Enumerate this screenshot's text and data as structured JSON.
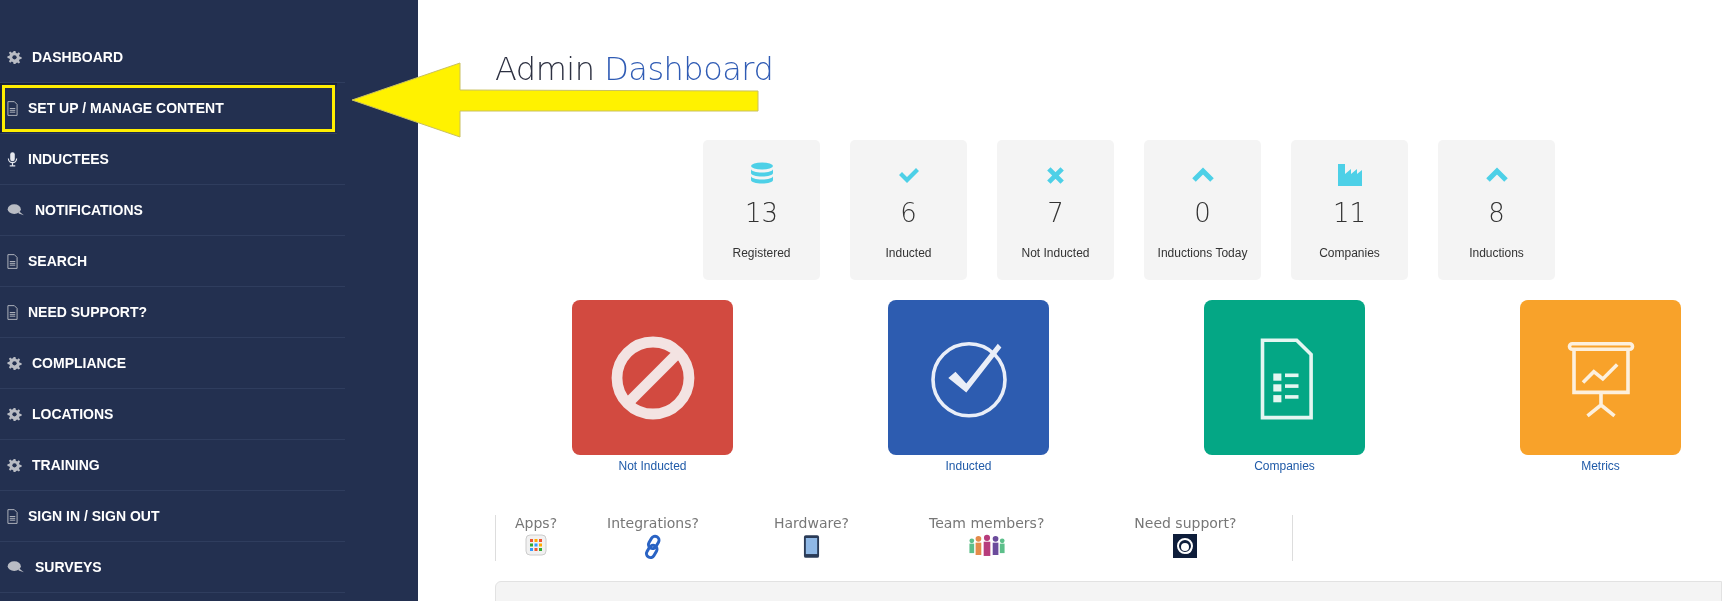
{
  "sidebar": {
    "items": [
      {
        "label": "DASHBOARD",
        "kind": "gear",
        "highlighted": false
      },
      {
        "label": "SET UP / MANAGE CONTENT",
        "kind": "doc",
        "highlighted": true
      },
      {
        "label": "INDUCTEES",
        "kind": "mic",
        "highlighted": false
      },
      {
        "label": "NOTIFICATIONS",
        "kind": "chat",
        "highlighted": false
      },
      {
        "label": "SEARCH",
        "kind": "doc",
        "highlighted": false
      },
      {
        "label": "NEED SUPPORT?",
        "kind": "doc",
        "highlighted": false
      },
      {
        "label": "COMPLIANCE",
        "kind": "gear",
        "highlighted": false
      },
      {
        "label": "LOCATIONS",
        "kind": "gear",
        "highlighted": false
      },
      {
        "label": "TRAINING",
        "kind": "gear",
        "highlighted": false
      },
      {
        "label": "SIGN IN / SIGN OUT",
        "kind": "doc",
        "highlighted": false
      },
      {
        "label": "SURVEYS",
        "kind": "chat",
        "highlighted": false
      }
    ]
  },
  "title": {
    "lead": "Admin",
    "accent": "Dashboard"
  },
  "stats": [
    {
      "kind": "database",
      "value": "13",
      "label": "Registered"
    },
    {
      "kind": "check",
      "value": "6",
      "label": "Inducted"
    },
    {
      "kind": "cross",
      "value": "7",
      "label": "Not Inducted"
    },
    {
      "kind": "chevron",
      "value": "0",
      "label": "Inductions Today"
    },
    {
      "kind": "factory",
      "value": "11",
      "label": "Companies"
    },
    {
      "kind": "chevron",
      "value": "8",
      "label": "Inductions"
    }
  ],
  "tiles": [
    {
      "kind": "ban",
      "label": "Not Inducted",
      "color": "#d24a40"
    },
    {
      "kind": "checkcircle",
      "label": "Inducted",
      "color": "#2d5cb0"
    },
    {
      "kind": "sheet",
      "label": "Companies",
      "color": "#04a785"
    },
    {
      "kind": "presentation",
      "label": "Metrics",
      "color": "#f8a22a"
    }
  ],
  "help_links": [
    {
      "label": "Apps?",
      "kind": "apps"
    },
    {
      "label": "Integrations?",
      "kind": "link"
    },
    {
      "label": "Hardware?",
      "kind": "tablet"
    },
    {
      "label": "Team members?",
      "kind": "people"
    },
    {
      "label": "Need support?",
      "kind": "headset"
    }
  ]
}
